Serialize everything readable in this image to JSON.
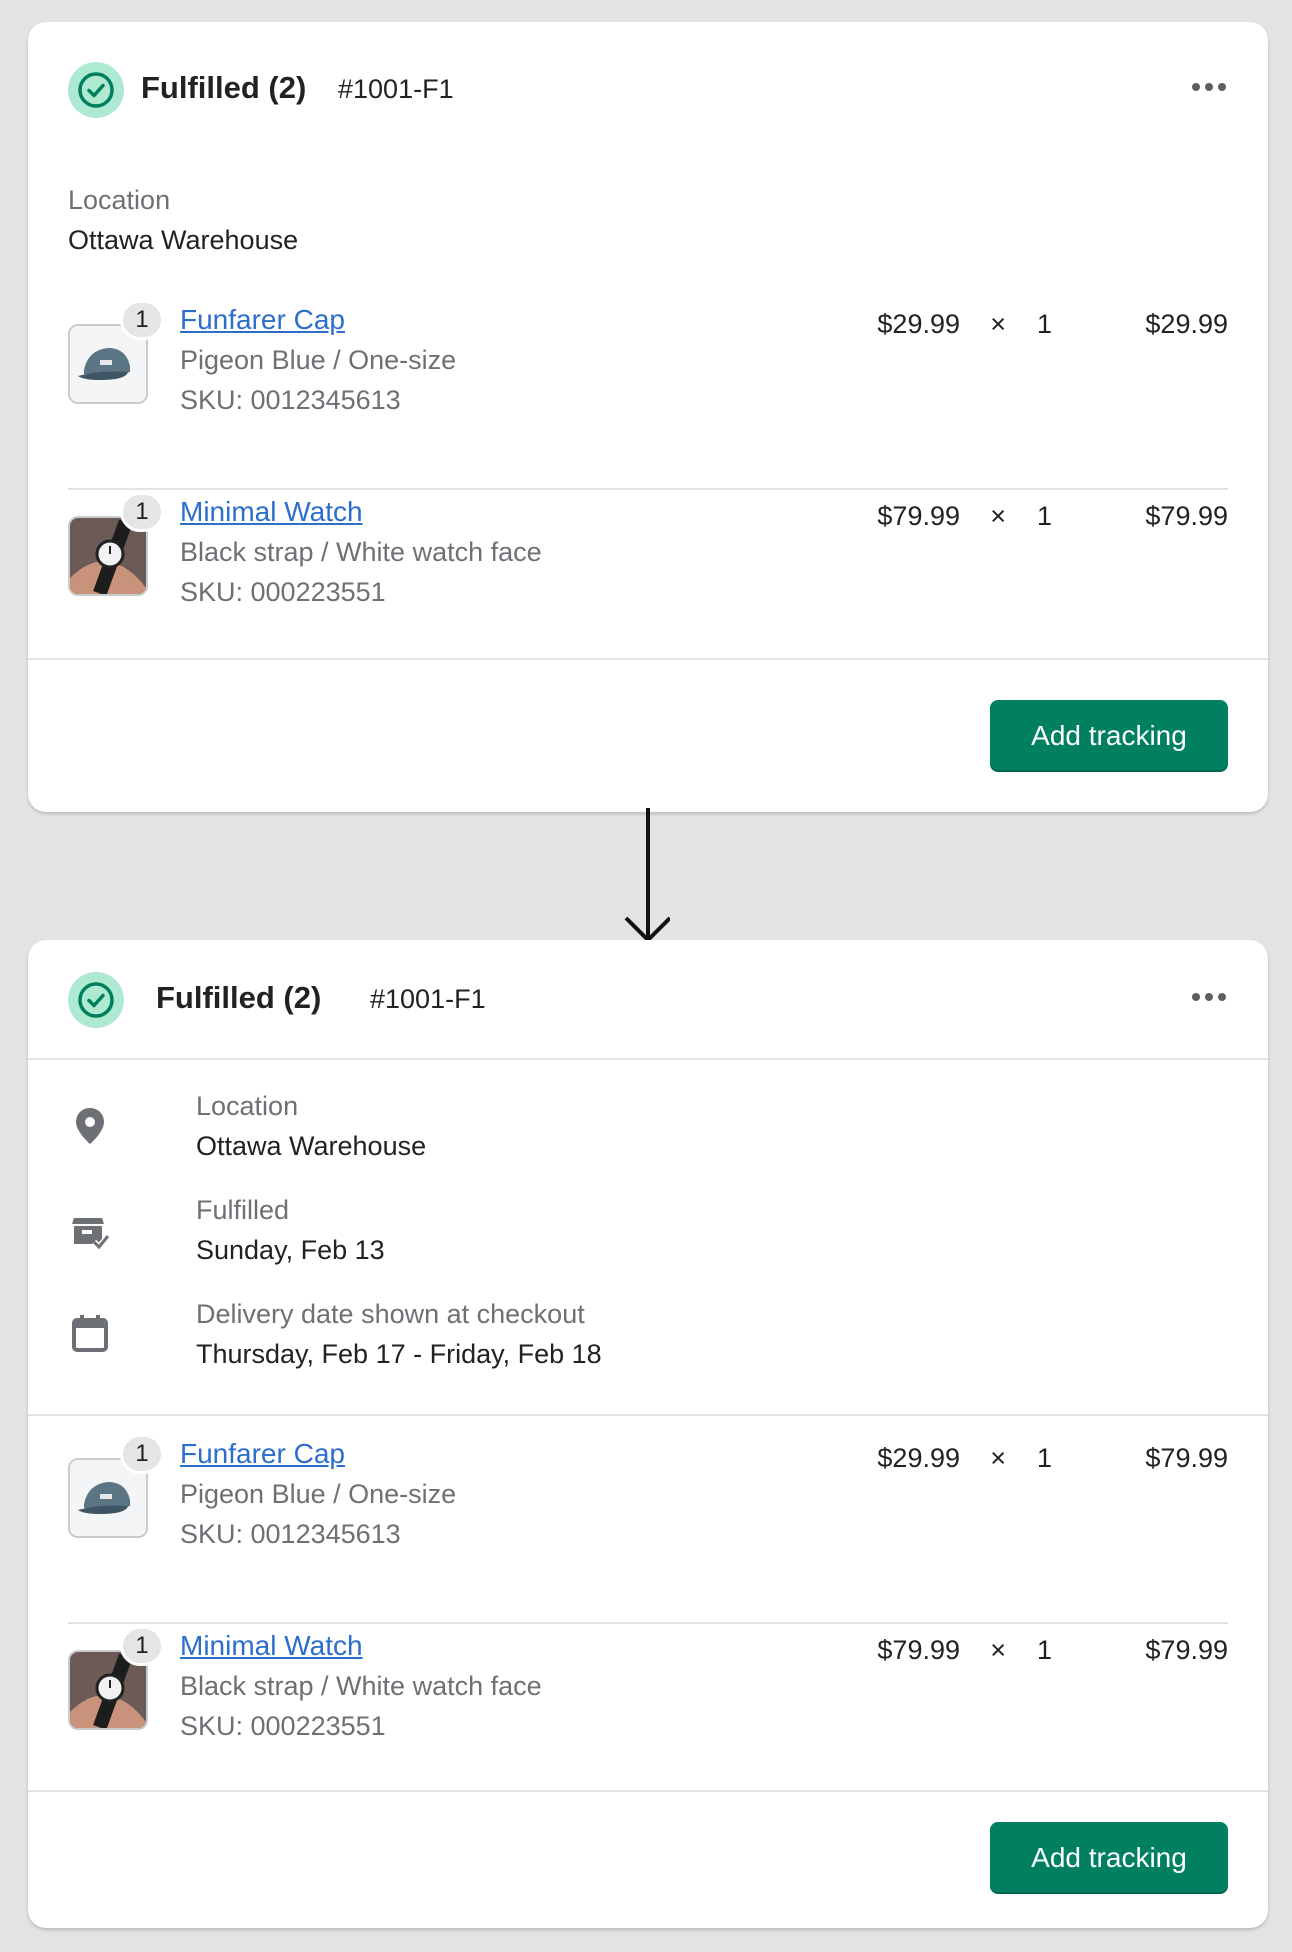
{
  "card1": {
    "status": "Fulfilled (2)",
    "order_number": "#1001-F1",
    "location_label": "Location",
    "location_value": "Ottawa Warehouse",
    "items": [
      {
        "qty": "1",
        "name": "Funfarer Cap",
        "variant": "Pigeon Blue / One-size",
        "sku": "SKU: 0012345613",
        "unit_price": "$29.99",
        "times": "×",
        "quantity": "1",
        "total": "$29.99"
      },
      {
        "qty": "1",
        "name": "Minimal Watch",
        "variant": "Black strap / White watch face",
        "sku": "SKU: 000223551",
        "unit_price": "$79.99",
        "times": "×",
        "quantity": "1",
        "total": "$79.99"
      }
    ],
    "button": "Add tracking"
  },
  "card2": {
    "status": "Fulfilled (2)",
    "order_number": "#1001-F1",
    "details": [
      {
        "icon": "location-pin-icon",
        "label": "Location",
        "value": "Ottawa Warehouse"
      },
      {
        "icon": "fulfilled-box-icon",
        "label": "Fulfilled",
        "value": "Sunday, Feb 13"
      },
      {
        "icon": "calendar-icon",
        "label": "Delivery date shown at checkout",
        "value": "Thursday, Feb 17 - Friday, Feb 18"
      }
    ],
    "items": [
      {
        "qty": "1",
        "name": "Funfarer Cap",
        "variant": "Pigeon Blue / One-size",
        "sku": "SKU: 0012345613",
        "unit_price": "$29.99",
        "times": "×",
        "quantity": "1",
        "total": "$79.99"
      },
      {
        "qty": "1",
        "name": "Minimal Watch",
        "variant": "Black strap / White watch face",
        "sku": "SKU: 000223551",
        "unit_price": "$79.99",
        "times": "×",
        "quantity": "1",
        "total": "$79.99"
      }
    ],
    "button": "Add tracking"
  },
  "colors": {
    "accent": "#008060",
    "link": "#2c6ecb",
    "success": "#aee9d1"
  }
}
